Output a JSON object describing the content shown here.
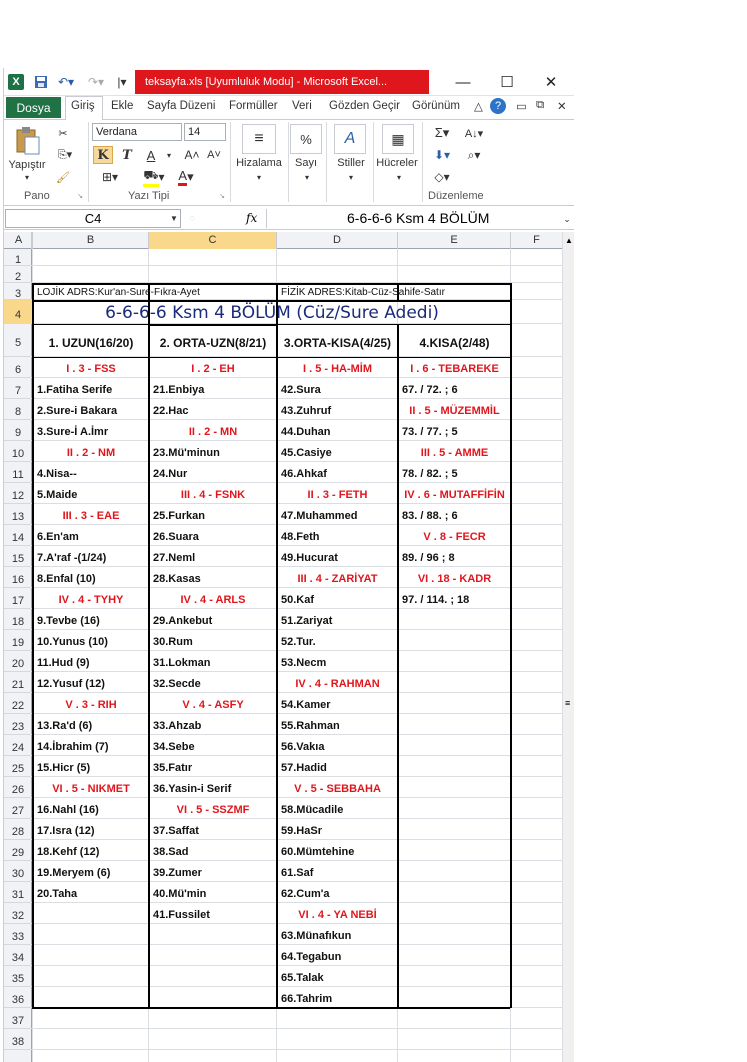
{
  "window": {
    "title": "teksayfa.xls  [Uyumluluk Modu]  -  Microsoft Excel..."
  },
  "menu": {
    "file": "Dosya",
    "tabs": [
      "Giriş",
      "Ekle",
      "Sayfa Düzeni",
      "Formüller",
      "Veri",
      "Gözden Geçir",
      "Görünüm"
    ]
  },
  "ribbon": {
    "paste": "Yapıştır",
    "clipboard": "Pano",
    "font_name": "Verdana",
    "font_size": "14",
    "font_group": "Yazı Tipi",
    "bold": "K",
    "italic": "T",
    "underline": "A",
    "align": "Hizalama",
    "number": "Sayı",
    "styles": "Stiller",
    "cells": "Hücreler",
    "editing": "Düzenleme"
  },
  "formula": {
    "name_box": "C4",
    "fx": "fx",
    "content": "6-6-6-6 Ksm 4  BÖLÜM"
  },
  "columns": [
    "A",
    "B",
    "C",
    "D",
    "E",
    "F"
  ],
  "rows": [
    "1",
    "2",
    "3",
    "4",
    "5",
    "6",
    "7",
    "8",
    "9",
    "10",
    "11",
    "12",
    "13",
    "14",
    "15",
    "16",
    "17",
    "18",
    "19",
    "20",
    "21",
    "22",
    "23",
    "24",
    "25",
    "26",
    "27",
    "28",
    "29",
    "30",
    "31",
    "32",
    "33",
    "34",
    "35",
    "36",
    "37",
    "38"
  ],
  "sheet": {
    "logic": "LOJİK ADRS:Kur'an-Sure-Fıkra-Ayet",
    "physical": "FİZİK ADRES:Kitab-Cüz-Sahife-Satır",
    "title": "6-6-6-6 Ksm 4  BÖLÜM  (Cüz/Sure Adedi)",
    "headers": [
      "1. UZUN(16/20)",
      "2. ORTA-UZN(8/21)",
      "3.ORTA-KISA(4/25)",
      "4.KISA(2/48)"
    ],
    "colB": [
      {
        "r": 6,
        "t": "I . 3 - FSS",
        "red": true
      },
      {
        "r": 7,
        "t": "1.Fatiha Serife"
      },
      {
        "r": 8,
        "t": "2.Sure-i Bakara"
      },
      {
        "r": 9,
        "t": "3.Sure-İ A.İmr"
      },
      {
        "r": 10,
        "t": "II . 2 -  NM",
        "red": true
      },
      {
        "r": 11,
        "t": "4.Nisa--"
      },
      {
        "r": 12,
        "t": "5.Maide"
      },
      {
        "r": 13,
        "t": "III . 3 - EAE",
        "red": true
      },
      {
        "r": 14,
        "t": "6.En'am"
      },
      {
        "r": 15,
        "t": "7.A'raf -(1/24)"
      },
      {
        "r": 16,
        "t": "8.Enfal (10)"
      },
      {
        "r": 17,
        "t": "IV . 4 -  TYHY",
        "red": true
      },
      {
        "r": 18,
        "t": "9.Tevbe (16)"
      },
      {
        "r": 19,
        "t": "10.Yunus (10)"
      },
      {
        "r": 20,
        "t": "11.Hud (9)"
      },
      {
        "r": 21,
        "t": "12.Yusuf (12)"
      },
      {
        "r": 22,
        "t": "V . 3 - RIH",
        "red": true
      },
      {
        "r": 23,
        "t": "13.Ra'd (6)"
      },
      {
        "r": 24,
        "t": "14.İbrahim (7)"
      },
      {
        "r": 25,
        "t": "15.Hicr (5)"
      },
      {
        "r": 26,
        "t": "VI . 5 - NIKMET",
        "red": true
      },
      {
        "r": 27,
        "t": "16.Nahl (16)"
      },
      {
        "r": 28,
        "t": "17.Isra (12)"
      },
      {
        "r": 29,
        "t": "18.Kehf (12)"
      },
      {
        "r": 30,
        "t": "19.Meryem (6)"
      },
      {
        "r": 31,
        "t": "20.Taha"
      }
    ],
    "colC": [
      {
        "r": 6,
        "t": "I . 2 - EH",
        "red": true
      },
      {
        "r": 7,
        "t": "21.Enbiya"
      },
      {
        "r": 8,
        "t": "22.Hac"
      },
      {
        "r": 9,
        "t": "II . 2 - MN",
        "red": true
      },
      {
        "r": 10,
        "t": "23.Mü'minun"
      },
      {
        "r": 11,
        "t": "24.Nur"
      },
      {
        "r": 12,
        "t": "III . 4 - FSNK",
        "red": true
      },
      {
        "r": 13,
        "t": "25.Furkan"
      },
      {
        "r": 14,
        "t": "26.Suara"
      },
      {
        "r": 15,
        "t": "27.Neml"
      },
      {
        "r": 16,
        "t": "28.Kasas"
      },
      {
        "r": 17,
        "t": "IV . 4 - ARLS",
        "red": true
      },
      {
        "r": 18,
        "t": "29.Ankebut"
      },
      {
        "r": 19,
        "t": "30.Rum"
      },
      {
        "r": 20,
        "t": "31.Lokman"
      },
      {
        "r": 21,
        "t": "32.Secde"
      },
      {
        "r": 22,
        "t": "V . 4 - ASFY",
        "red": true
      },
      {
        "r": 23,
        "t": "33.Ahzab"
      },
      {
        "r": 24,
        "t": "34.Sebe"
      },
      {
        "r": 25,
        "t": "35.Fatır"
      },
      {
        "r": 26,
        "t": "36.Yasin-i Serif"
      },
      {
        "r": 27,
        "t": "VI . 5 - SSZMF",
        "red": true
      },
      {
        "r": 28,
        "t": "37.Saffat"
      },
      {
        "r": 29,
        "t": "38.Sad"
      },
      {
        "r": 30,
        "t": "39.Zumer"
      },
      {
        "r": 31,
        "t": "40.Mü'min"
      },
      {
        "r": 32,
        "t": "41.Fussilet"
      }
    ],
    "colD": [
      {
        "r": 6,
        "t": "I . 5 - HA-MİM",
        "red": true
      },
      {
        "r": 7,
        "t": "42.Sura"
      },
      {
        "r": 8,
        "t": "43.Zuhruf"
      },
      {
        "r": 9,
        "t": "44.Duhan"
      },
      {
        "r": 10,
        "t": "45.Casiye"
      },
      {
        "r": 11,
        "t": "46.Ahkaf"
      },
      {
        "r": 12,
        "t": "II . 3 - FETH",
        "red": true
      },
      {
        "r": 13,
        "t": "47.Muhammed"
      },
      {
        "r": 14,
        "t": "48.Feth"
      },
      {
        "r": 15,
        "t": "49.Hucurat"
      },
      {
        "r": 16,
        "t": "III . 4 - ZARİYAT",
        "red": true
      },
      {
        "r": 17,
        "t": "50.Kaf"
      },
      {
        "r": 18,
        "t": "51.Zariyat"
      },
      {
        "r": 19,
        "t": "52.Tur."
      },
      {
        "r": 20,
        "t": "53.Necm"
      },
      {
        "r": 21,
        "t": "IV . 4 - RAHMAN",
        "red": true
      },
      {
        "r": 22,
        "t": "54.Kamer"
      },
      {
        "r": 23,
        "t": "55.Rahman"
      },
      {
        "r": 24,
        "t": "56.Vakıa"
      },
      {
        "r": 25,
        "t": "57.Hadid"
      },
      {
        "r": 26,
        "t": "V . 5 - SEBBAHA",
        "red": true
      },
      {
        "r": 27,
        "t": "58.Mücadile"
      },
      {
        "r": 28,
        "t": "59.HaSr"
      },
      {
        "r": 29,
        "t": "60.Mümtehine"
      },
      {
        "r": 30,
        "t": "61.Saf"
      },
      {
        "r": 31,
        "t": "62.Cum'a"
      },
      {
        "r": 32,
        "t": "VI . 4 - YA NEBİ",
        "red": true
      },
      {
        "r": 33,
        "t": "63.Münafıkun"
      },
      {
        "r": 34,
        "t": "64.Tegabun"
      },
      {
        "r": 35,
        "t": "65.Talak"
      },
      {
        "r": 36,
        "t": "66.Tahrim"
      }
    ],
    "colE": [
      {
        "r": 6,
        "t": "I . 6 - TEBAREKE",
        "red": true
      },
      {
        "r": 7,
        "t": "67. / 72. ; 6"
      },
      {
        "r": 8,
        "t": "II . 5 - MÜZEMMİL",
        "red": true
      },
      {
        "r": 9,
        "t": "73. /  77.  ; 5"
      },
      {
        "r": 10,
        "t": "III . 5 - AMME",
        "red": true
      },
      {
        "r": 11,
        "t": "78. / 82. ; 5"
      },
      {
        "r": 12,
        "t": "IV . 6 - MUTAFFİFİN",
        "red": true
      },
      {
        "r": 13,
        "t": "83. / 88. ; 6"
      },
      {
        "r": 14,
        "t": "V . 8 - FECR",
        "red": true
      },
      {
        "r": 15,
        "t": "89. / 96 ; 8"
      },
      {
        "r": 16,
        "t": "VI . 18 - KADR",
        "red": true
      },
      {
        "r": 17,
        "t": "97. / 114. ; 18"
      }
    ]
  }
}
